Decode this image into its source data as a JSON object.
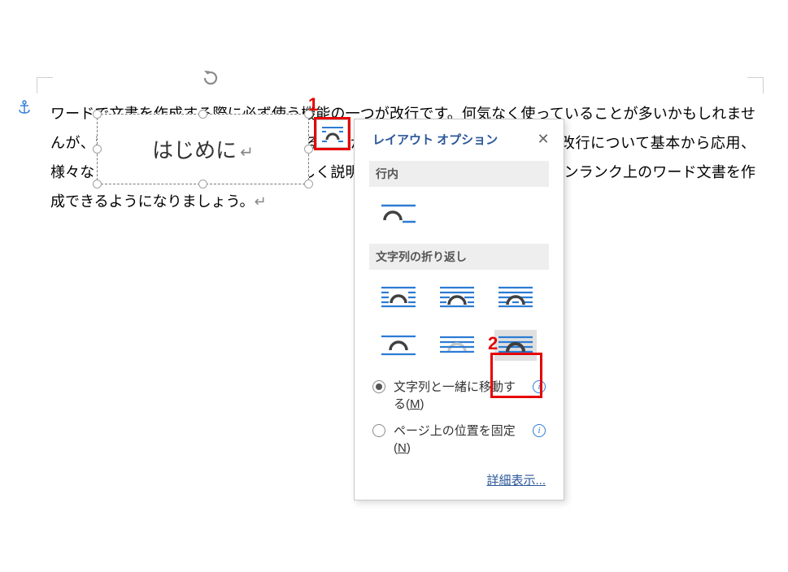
{
  "document": {
    "paragraph": "ワードで文書を作成する際に必ず使う機能の一つが改行です。何気なく使っていることが多いかもしれませんが、種類によっては改行幅を削除することができたり奥が深い機能です。改行について基本から応用、様々なトラブルの対処法なども交え詳しく説明しています。改行を理解してワンランク上のワード文書を作成できるようになりましょう。",
    "textbox": "はじめに"
  },
  "callouts": {
    "c1": "1",
    "c2": "2"
  },
  "popup": {
    "title": "レイアウト オプション",
    "section_inline": "行内",
    "section_wrap": "文字列の折り返し",
    "radios": {
      "move_with_text": "文字列と一緒に移動する(",
      "move_with_text_key": "M",
      "fix_on_page": "ページ上の位置を固定(",
      "fix_on_page_key": "N",
      "close_paren": ")"
    },
    "details": "詳細表示..."
  }
}
